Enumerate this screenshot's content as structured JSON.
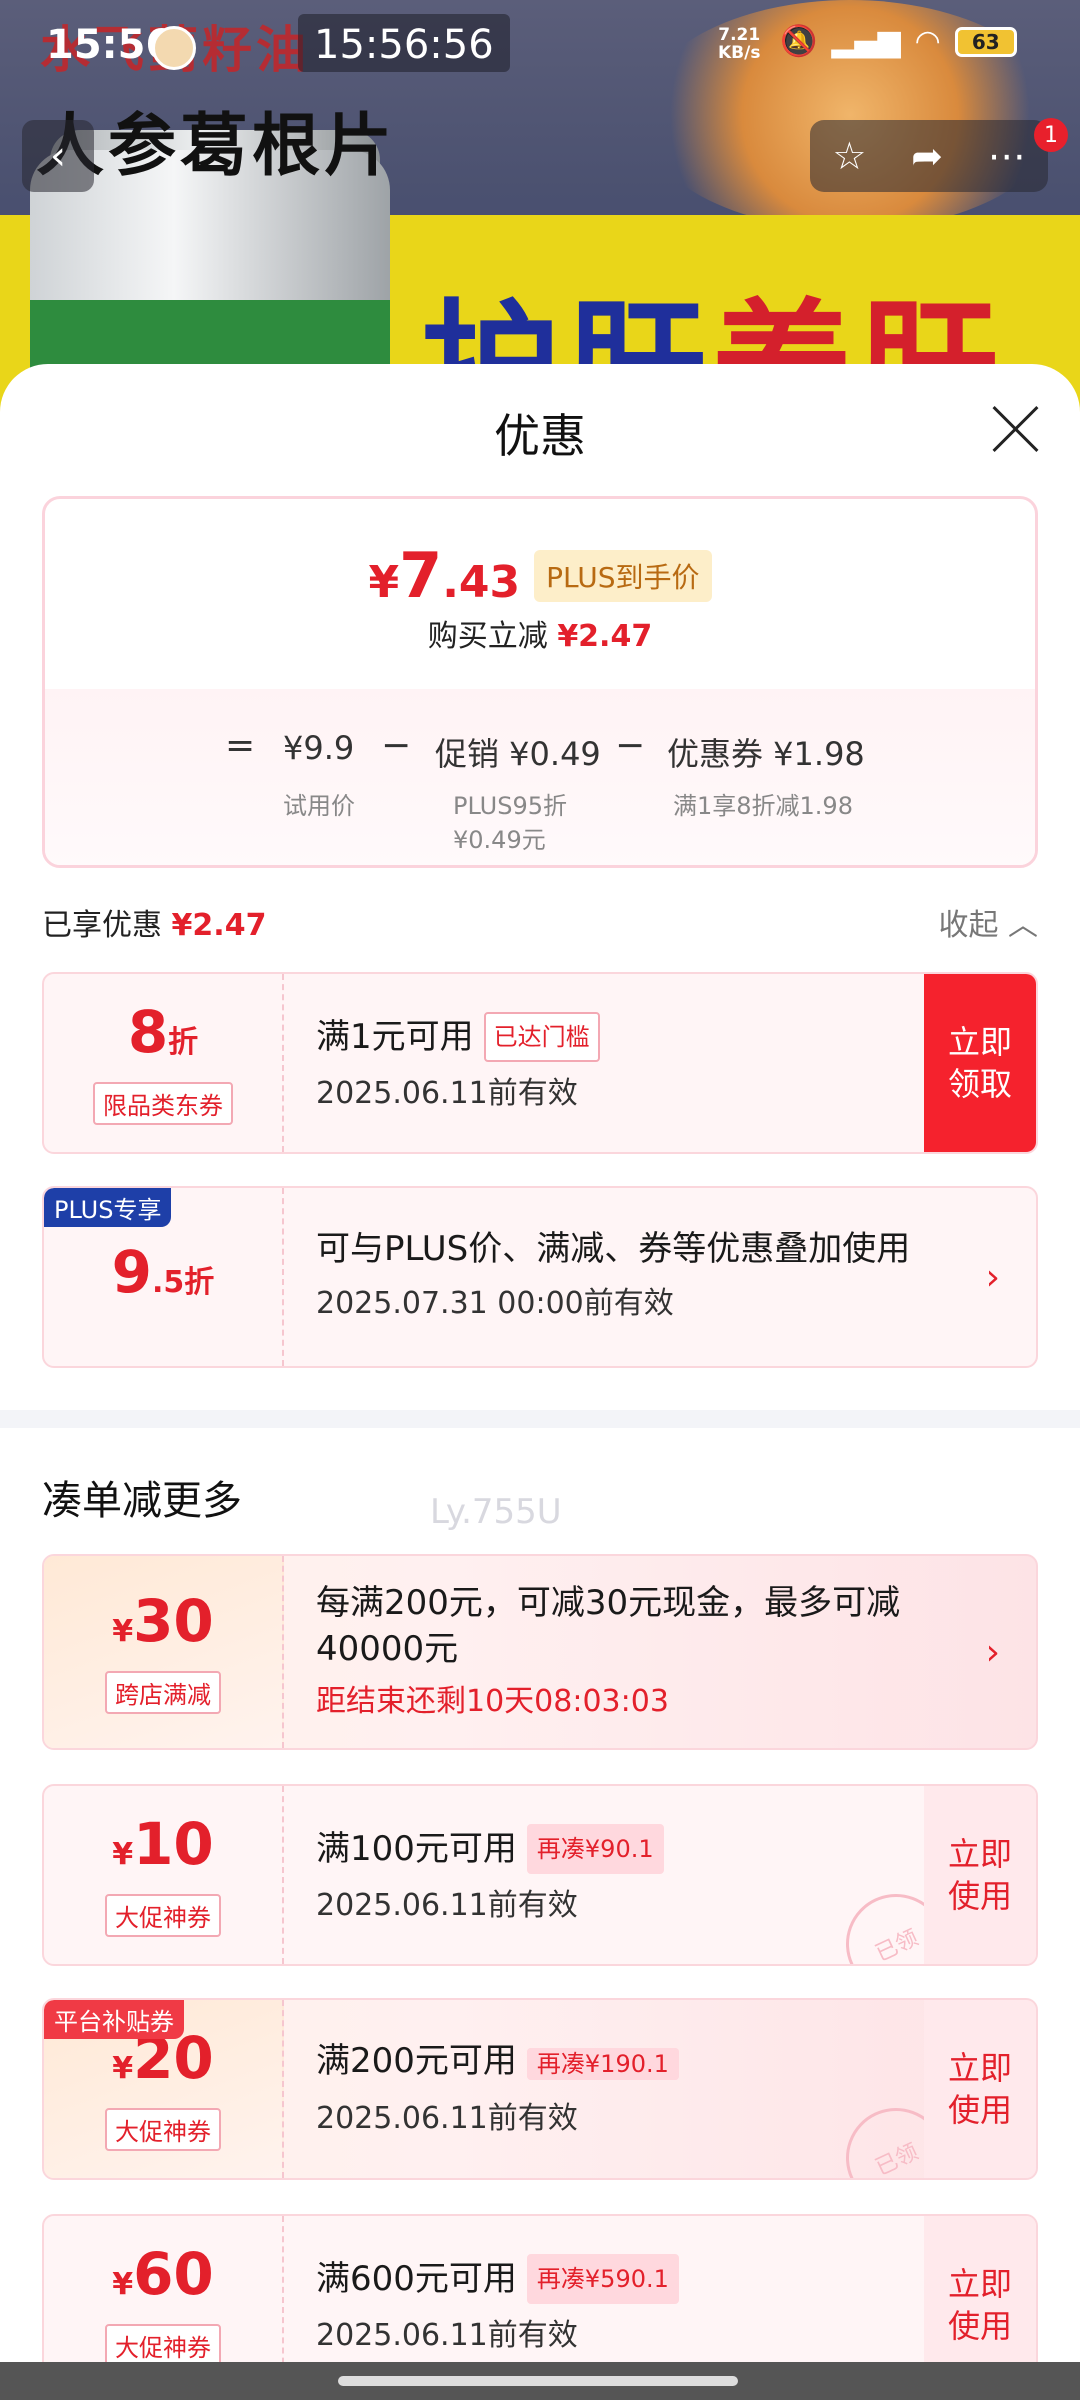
{
  "banner": {
    "title_top": "水飞蓟籽油",
    "title_main": "人参葛根片",
    "slogan_blue": "护肝",
    "slogan_red": "养肝"
  },
  "status_bar": {
    "time": "15:56",
    "time_overlay": "15:56:56",
    "net_speed_value": "7.21",
    "net_speed_unit": "KB/s",
    "battery": "63"
  },
  "nav": {
    "badge_count": "1"
  },
  "sheet": {
    "title": "优惠",
    "price": {
      "currency": "¥",
      "integer": "7",
      "decimal": ".43",
      "tag": "PLUS到手价",
      "save_label": "购买立减",
      "save_amount": "¥2.47"
    },
    "formula": {
      "eq": "=",
      "trial_price": "¥9.9",
      "trial_label": "试用价",
      "minus1": "−",
      "promo": "促销 ¥0.49",
      "promo_sub1": "PLUS95折",
      "promo_sub2": "¥0.49元",
      "minus2": "−",
      "coupon": "优惠券 ¥1.98",
      "coupon_sub": "满1享8折减1.98"
    },
    "enjoyed_label": "已享优惠",
    "enjoyed_amount": "¥2.47",
    "collapse_label": "收起 ︿",
    "coupons": [
      {
        "value": "8",
        "unit": "折",
        "type": "限品类东券",
        "main": "满1元可用",
        "pill": "已达门槛",
        "date": "2025.06.11前有效",
        "cta": "立即\n领取"
      },
      {
        "corner": "PLUS专享",
        "value": "9",
        "unit": ".5折",
        "main": "可与PLUS价、满减、券等优惠叠加使用",
        "date": "2025.07.31 00:00前有效",
        "arrow": "›"
      }
    ],
    "more_title": "凑单减更多",
    "promos": [
      {
        "value": "30",
        "currency": "¥",
        "type": "跨店满减",
        "main": "每满200元，可减30元现金，最多可减40000元",
        "countdown": "距结束还剩10天08:03:03",
        "arrow": "›"
      },
      {
        "value": "10",
        "currency": "¥",
        "type": "大促神券",
        "main": "满100元可用",
        "pill": "再凑¥90.1",
        "date": "2025.06.11前有效",
        "cta": "立即\n使用",
        "stamp": "已领"
      },
      {
        "corner": "平台补贴券",
        "value": "20",
        "currency": "¥",
        "type": "大促神券",
        "main": "满200元可用",
        "pill": "再凑¥190.1",
        "date": "2025.06.11前有效",
        "cta": "立即\n使用",
        "stamp": "已领"
      },
      {
        "value": "60",
        "currency": "¥",
        "type": "大促神券",
        "main": "满600元可用",
        "pill": "再凑¥590.1",
        "date": "2025.06.11前有效",
        "cta": "立即\n使用"
      }
    ],
    "watermark": "Ly.755U"
  },
  "colors": {
    "accent_red": "#e3202b",
    "plus_blue": "#1e3fa8",
    "plus_gold": "#b86a12"
  }
}
